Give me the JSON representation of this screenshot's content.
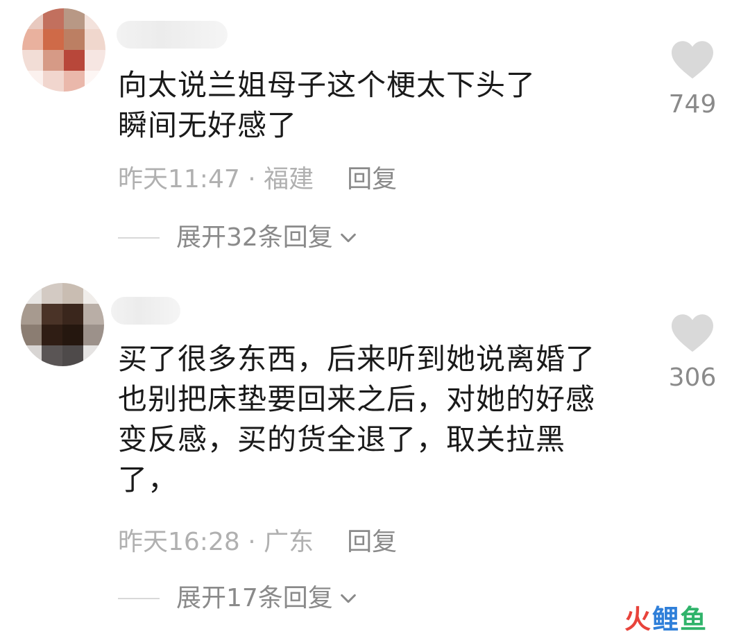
{
  "comments": [
    {
      "text": "向太说兰姐母子这个梗太下头了\n瞬间无好感了",
      "time": "昨天11:47",
      "location": "福建",
      "reply_label": "回复",
      "expand_label": "展开32条回复",
      "likes": "749"
    },
    {
      "text": "买了很多东西，后来听到她说离婚了\n也别把床垫要回来之后，对她的好感\n变反感，买的货全退了，取关拉黑\n了，",
      "time": "昨天16:28",
      "location": "广东",
      "reply_label": "回复",
      "expand_label": "展开17条回复",
      "likes": "306"
    }
  ],
  "meta_separator": " · ",
  "icons": {
    "like": "heart-icon",
    "expand": "chevron-down-icon"
  },
  "watermark": {
    "part1": "火",
    "part2": "鲤",
    "part3": "鱼"
  },
  "colors": {
    "heart": "#d9d9d9",
    "text": "#1a1a1a",
    "muted": "#b0b0b0",
    "reply": "#8a8a8a"
  }
}
